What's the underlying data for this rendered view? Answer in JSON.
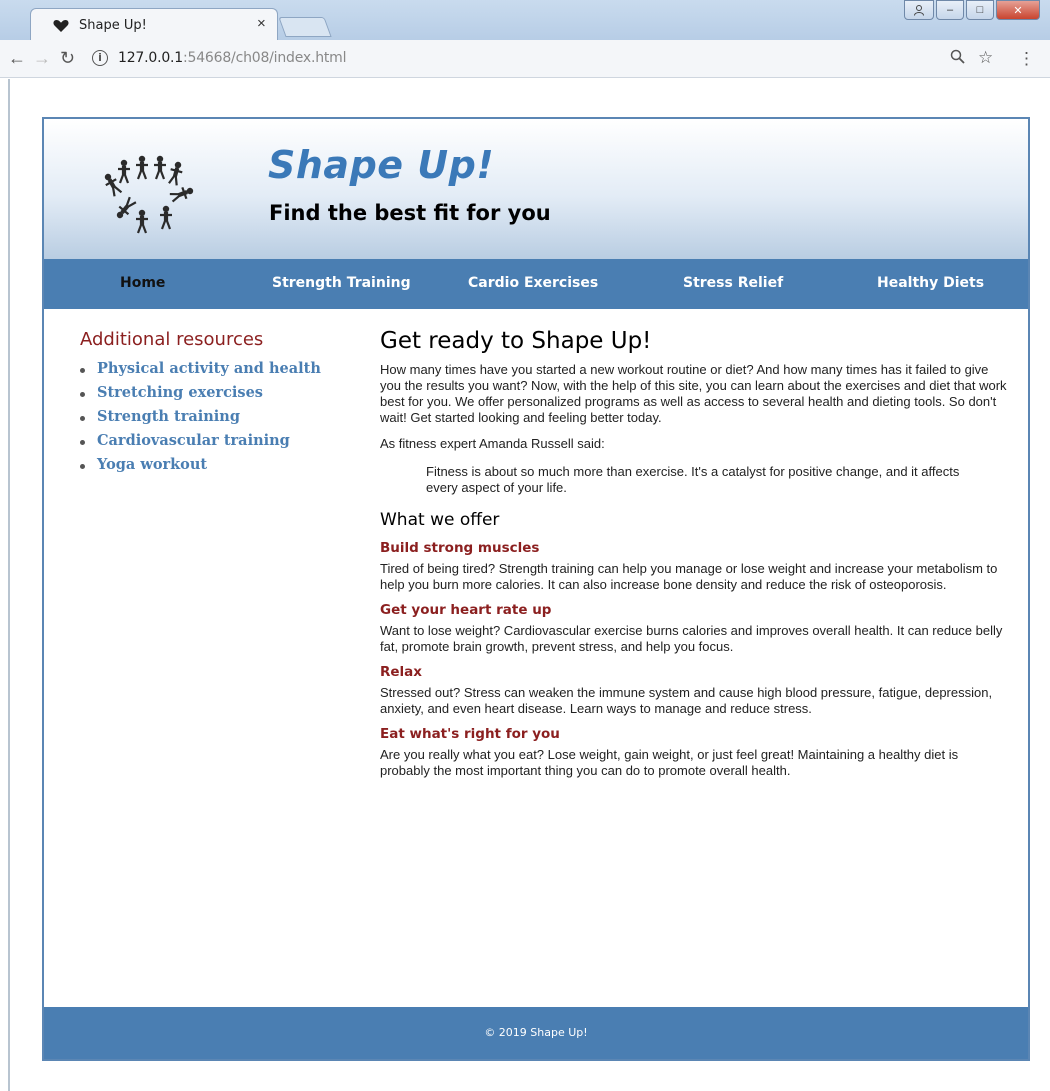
{
  "browser": {
    "tab_title": "Shape Up!",
    "tab_close": "×",
    "url_host": "127.0.0.1",
    "url_rest": ":54668/ch08/index.html",
    "win_minimize": "–",
    "win_restore": "□",
    "win_close": "✕"
  },
  "header": {
    "title": "Shape Up!",
    "tagline": "Find the best fit for you"
  },
  "nav": {
    "items": [
      "Home",
      "Strength Training",
      "Cardio Exercises",
      "Stress Relief",
      "Healthy Diets"
    ]
  },
  "sidebar": {
    "title": "Additional resources",
    "items": [
      "Physical activity and health",
      "Stretching exercises",
      "Strength training",
      "Cardiovascular training",
      "Yoga workout"
    ]
  },
  "main": {
    "heading": "Get ready to Shape Up!",
    "intro": "How many times have you started a new workout routine or diet? And how many times has it failed to give you the results you want? Now, with the help of this site, you can learn about the exercises and diet that work best for you. We offer personalized programs as well as access to several health and dieting tools. So don't wait! Get started looking and feeling better today.",
    "quote_intro": "As fitness expert Amanda Russell said:",
    "quote": "Fitness is about so much more than exercise. It's a catalyst for positive change, and it affects every aspect of your life.",
    "subheading": "What we offer",
    "offers": [
      {
        "title": "Build strong muscles",
        "text": "Tired of being tired? Strength training can help you manage or lose weight and increase your metabolism to help you burn more calories. It can also increase bone density and reduce the risk of osteoporosis."
      },
      {
        "title": "Get your heart rate up",
        "text": "Want to lose weight? Cardiovascular exercise burns calories and improves overall health. It can reduce belly fat, promote brain growth, prevent stress, and help you focus."
      },
      {
        "title": "Relax",
        "text": "Stressed out? Stress can weaken the immune system and cause high blood pressure, fatigue, depression, anxiety, and even heart disease. Learn ways to manage and reduce stress."
      },
      {
        "title": "Eat what's right for you",
        "text": "Are you really what you eat? Lose weight, gain weight, or just feel great! Maintaining a healthy diet is probably the most important thing you can do to promote overall health."
      }
    ]
  },
  "footer": {
    "text": "© 2019 Shape Up!"
  },
  "colors": {
    "accent_blue": "#4a7eb2",
    "heading_red": "#8b1f1f",
    "title_blue": "#3b79b8"
  }
}
